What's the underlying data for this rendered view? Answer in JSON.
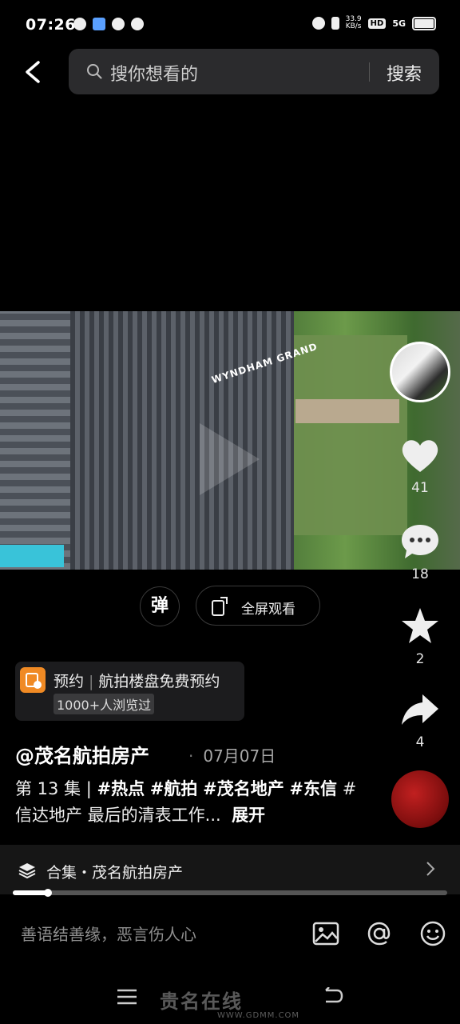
{
  "status_bar": {
    "time": "07:26",
    "net_speed_value": "33.9",
    "net_speed_unit": "KB/s",
    "hd": "HD",
    "signal": "5G"
  },
  "search": {
    "placeholder": "搜你想看的",
    "button": "搜索"
  },
  "video": {
    "building_sign": "WYNDHAM GRAND"
  },
  "rail": {
    "likes": "41",
    "comments": "18",
    "favorites": "2",
    "shares": "4"
  },
  "controls": {
    "danmu_label": "弹",
    "fullscreen_label": "全屏观看"
  },
  "booking": {
    "label": "预约",
    "title": "航拍楼盘免费预约",
    "badge": "1000+人浏览过"
  },
  "post": {
    "author": "@茂名航拍房产",
    "date": "07月07日",
    "episode": "第 13 集 | ",
    "tags": [
      "#热点",
      "#航拍",
      "#茂名地产",
      "#东信"
    ],
    "tag_plain": "#信达地产",
    "text": " 最后的清表工作...",
    "expand": "展开"
  },
  "collection": {
    "label": "合集・茂名航拍房产",
    "progress": 0.08
  },
  "comment": {
    "placeholder": "善语结善缘，恶言伤人心"
  },
  "watermark": {
    "text": "贵名在线",
    "url": "WWW.GDMM.COM"
  }
}
